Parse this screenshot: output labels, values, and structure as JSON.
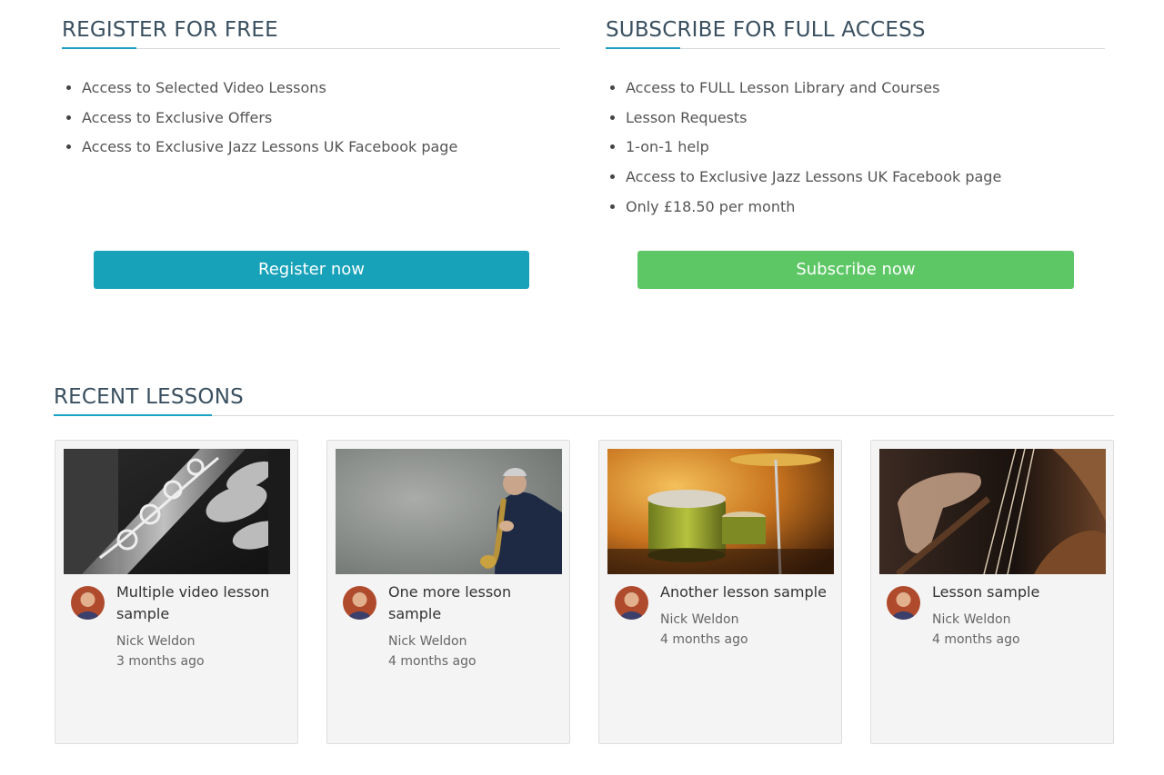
{
  "register": {
    "title": "REGISTER FOR FREE",
    "items": [
      "Access to Selected Video Lessons",
      "Access to Exclusive Offers",
      "Access to Exclusive Jazz Lessons UK Facebook page"
    ],
    "button_label": "Register now",
    "button_color": "#17a2ba"
  },
  "subscribe": {
    "title": "SUBSCRIBE FOR FULL ACCESS",
    "items": [
      "Access to FULL Lesson Library and Courses",
      "Lesson Requests",
      "1-on-1 help",
      "Access to Exclusive Jazz Lessons UK Facebook page",
      "Only £18.50 per month"
    ],
    "button_label": "Subscribe now",
    "button_color": "#5cc764"
  },
  "recent": {
    "title": "RECENT LESSONS",
    "lessons": [
      {
        "title": "Multiple video lesson sample",
        "author": "Nick Weldon",
        "time": "3 months ago",
        "thumbnail": "saxophone-keys-photo"
      },
      {
        "title": "One more lesson sample",
        "author": "Nick Weldon",
        "time": "4 months ago",
        "thumbnail": "saxophonist-photo"
      },
      {
        "title": "Another lesson sample",
        "author": "Nick Weldon",
        "time": "4 months ago",
        "thumbnail": "drum-kit-photo"
      },
      {
        "title": "Lesson sample",
        "author": "Nick Weldon",
        "time": "4 months ago",
        "thumbnail": "double-bass-photo"
      }
    ]
  },
  "colors": {
    "accent": "#17a2c3",
    "heading": "#3a5060"
  }
}
